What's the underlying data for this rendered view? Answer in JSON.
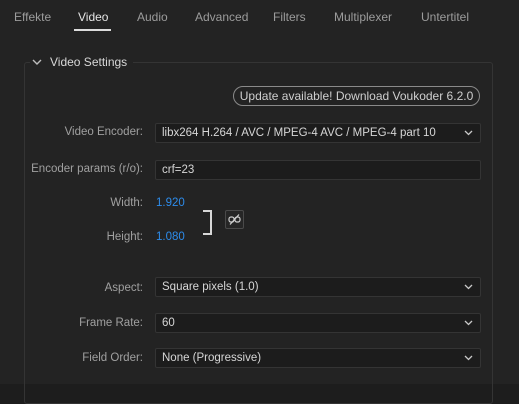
{
  "tabs": [
    {
      "label": "Effekte"
    },
    {
      "label": "Video"
    },
    {
      "label": "Audio"
    },
    {
      "label": "Advanced"
    },
    {
      "label": "Filters"
    },
    {
      "label": "Multiplexer"
    },
    {
      "label": "Untertitel"
    }
  ],
  "active_tab": "Video",
  "group": {
    "title": "Video Settings"
  },
  "update_button": {
    "label": "Update available! Download Voukoder 6.2.0"
  },
  "video_encoder": {
    "label": "Video Encoder:",
    "value": "libx264 H.264 / AVC / MPEG-4 AVC / MPEG-4 part 10"
  },
  "encoder_params": {
    "label": "Encoder params (r/o):",
    "value": "crf=23"
  },
  "width": {
    "label": "Width:",
    "value": "1.920"
  },
  "height": {
    "label": "Height:",
    "value": "1.080"
  },
  "aspect": {
    "label": "Aspect:",
    "value": "Square pixels (1.0)"
  },
  "frame_rate": {
    "label": "Frame Rate:",
    "value": "60"
  },
  "field_order": {
    "label": "Field Order:",
    "value": "None (Progressive)"
  },
  "colors": {
    "accent_blue": "#2d8ceb",
    "background": "#232323",
    "field_bg": "#1c1c1c"
  }
}
